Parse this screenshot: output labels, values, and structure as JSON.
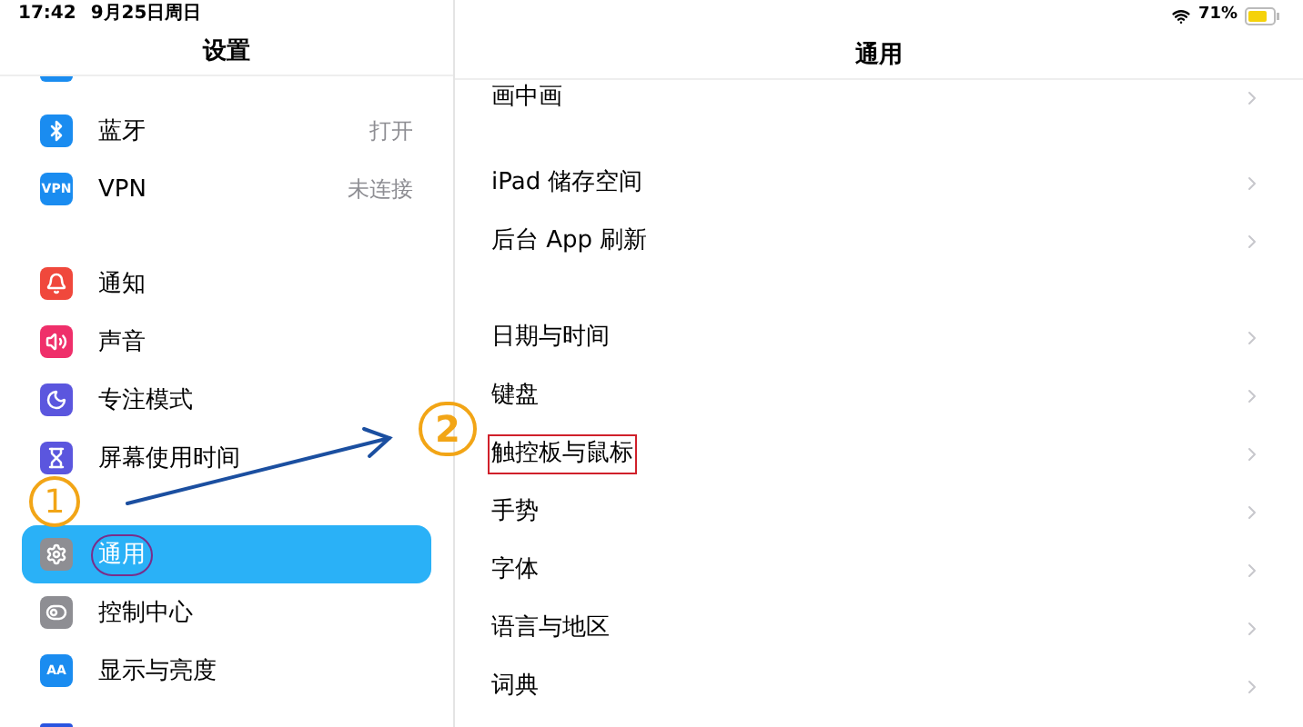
{
  "status_bar": {
    "time": "17:42",
    "date": "9月25日周日",
    "battery": "71%"
  },
  "sidebar": {
    "title": "设置",
    "groups": [
      [
        {
          "label": "蓝牙",
          "value": "打开",
          "kind": "bluetooth",
          "color": "#1a8cf0",
          "selected": false,
          "circled": false
        },
        {
          "label": "VPN",
          "value": "未连接",
          "kind": "text",
          "icon_text": "VPN",
          "color": "#1a8cf0",
          "selected": false,
          "circled": false
        }
      ],
      [
        {
          "label": "通知",
          "kind": "bell",
          "color": "#f0483c",
          "selected": false,
          "circled": false
        },
        {
          "label": "声音",
          "kind": "sound",
          "color": "#ef2f6a",
          "selected": false,
          "circled": false
        },
        {
          "label": "专注模式",
          "kind": "moon",
          "color": "#5b56de",
          "selected": false,
          "circled": false
        },
        {
          "label": "屏幕使用时间",
          "kind": "hourglass",
          "color": "#5b56de",
          "selected": false,
          "circled": false
        }
      ],
      [
        {
          "label": "通用",
          "kind": "gear",
          "color": "#8e8e93",
          "selected": true,
          "circled": true
        },
        {
          "label": "控制中心",
          "kind": "toggles",
          "color": "#8e8e93",
          "selected": false,
          "circled": false
        },
        {
          "label": "显示与亮度",
          "kind": "text",
          "icon_text": "AA",
          "color": "#1a8cf0",
          "selected": false,
          "circled": false
        }
      ]
    ]
  },
  "detail": {
    "title": "通用",
    "groups": [
      [
        {
          "label": "画中画",
          "highlighted": false
        }
      ],
      [
        {
          "label": "iPad 储存空间",
          "highlighted": false
        },
        {
          "label": "后台 App 刷新",
          "highlighted": false
        }
      ],
      [
        {
          "label": "日期与时间",
          "highlighted": false
        },
        {
          "label": "键盘",
          "highlighted": false
        },
        {
          "label": "触控板与鼠标",
          "highlighted": true
        },
        {
          "label": "手势",
          "highlighted": false
        },
        {
          "label": "字体",
          "highlighted": false
        },
        {
          "label": "语言与地区",
          "highlighted": false
        },
        {
          "label": "词典",
          "highlighted": false
        }
      ]
    ]
  },
  "annotations": [
    {
      "kind": "step",
      "label": "1"
    },
    {
      "kind": "step",
      "label": "2"
    }
  ]
}
